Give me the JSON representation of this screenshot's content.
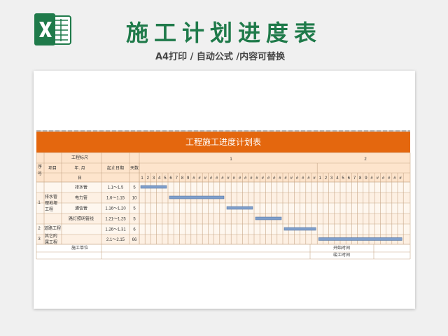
{
  "header": {
    "title": "施工计划进度表",
    "subtitle": "A4打印 / 自动公式 /内容可替换"
  },
  "sheet": {
    "banner_title": "工程施工进度计划表",
    "headers": {
      "seq_top": "序",
      "seq_bottom": "号",
      "project": "项目",
      "marker": "工程标尺",
      "yearmonth": "年. 月",
      "day": "日",
      "start_end": "起止日期",
      "days": "天数"
    },
    "months": [
      "1",
      "2"
    ],
    "day_cells_month1": [
      "1",
      "2",
      "3",
      "4",
      "5",
      "6",
      "7",
      "8",
      "9",
      "#",
      "#",
      "#",
      "#",
      "#",
      "#",
      "#",
      "#",
      "#",
      "#",
      "#",
      "#",
      "#",
      "#",
      "#",
      "#",
      "#",
      "#",
      "#",
      "#",
      "#",
      "#"
    ],
    "day_cells_month2": [
      "1",
      "2",
      "3",
      "4",
      "5",
      "6",
      "7",
      "8",
      "9",
      "#",
      "#",
      "#",
      "#",
      "#",
      "#"
    ],
    "groups": [
      {
        "seq": "1",
        "project": "排水管理地埋工程"
      },
      {
        "seq": "2",
        "project": "道路工程"
      },
      {
        "seq": "3",
        "project": "其它附属工程"
      }
    ],
    "rows": [
      {
        "item": "排水管",
        "dates": "1.1～1.5",
        "days": "5",
        "start": 1,
        "end": 5
      },
      {
        "item": "电力管",
        "dates": "1.6～1.15",
        "days": "10",
        "start": 6,
        "end": 15
      },
      {
        "item": "通信管",
        "dates": "1.16～1.20",
        "days": "5",
        "start": 16,
        "end": 20
      },
      {
        "item": "路灯照明管线",
        "dates": "1.21～1.25",
        "days": "5",
        "start": 21,
        "end": 25
      },
      {
        "item": "",
        "dates": "1.26～1.31",
        "days": "6",
        "start": 26,
        "end": 31
      },
      {
        "item": "",
        "dates": "2.1～2.15",
        "days": "66",
        "start": 32,
        "end": 46
      }
    ],
    "footer": {
      "unit_label": "施工单位",
      "start_time": "开始时间",
      "end_time": "竣工时间"
    },
    "colors": {
      "banner": "#e4670e",
      "header_fill": "#fde4cc",
      "row_fill": "#fdf0e3",
      "bar": "#7f9fcb",
      "grid": "#c9a98a"
    }
  }
}
